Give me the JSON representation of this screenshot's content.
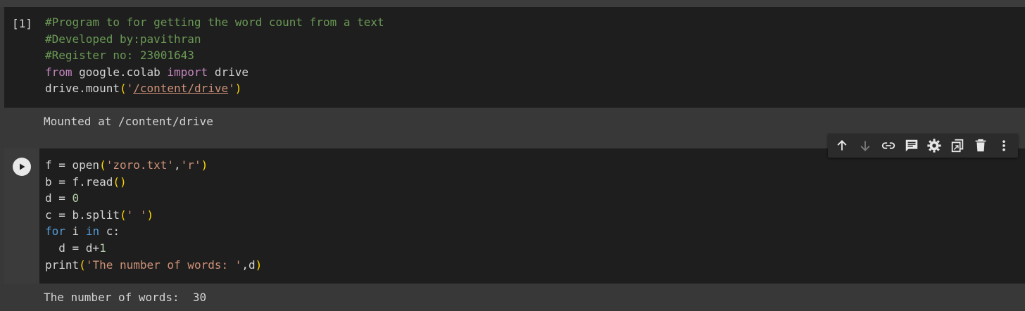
{
  "cells": [
    {
      "execution_count": "[1]",
      "code_lines": [
        "#Program to for getting the word count from a text",
        "#Developed by:pavithran",
        "#Register no: 23001643",
        "from google.colab import drive",
        "drive.mount('/content/drive')"
      ],
      "output": "Mounted at /content/drive"
    },
    {
      "code_lines": [
        "f = open('zoro.txt','r')",
        "b = f.read()",
        "d = 0",
        "c = b.split(' ')",
        "for i in c:",
        "  d = d+1",
        "print('The number of words: ',d)"
      ],
      "output": "The number of words:  30"
    }
  ],
  "toolbar": {
    "icons": [
      "arrow-up-icon",
      "arrow-down-icon",
      "link-icon",
      "comment-icon",
      "gear-icon",
      "mirror-cell-icon",
      "trash-icon",
      "more-vert-icon"
    ]
  },
  "colors": {
    "comment": "#6a9955",
    "keyword": "#c586c0",
    "builtin_keyword": "#569cd6",
    "string": "#ce9178",
    "bracket": "#ffd700",
    "number": "#b5cea8",
    "text": "#d4d4d4",
    "cell_bg": "#1e1e1e",
    "page_bg": "#383838"
  }
}
